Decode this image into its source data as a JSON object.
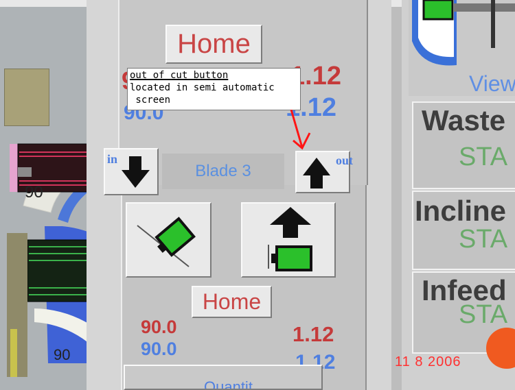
{
  "top_section": {
    "home_label": "Home",
    "red_value_left": "9",
    "red_value_right": "1.12",
    "blue_value_left": "90.0",
    "blue_value_right": "1.12"
  },
  "annotation": {
    "line1": "out of cut button",
    "line2": "located in semi automatic",
    "line3": " screen"
  },
  "blade_row": {
    "in_label": "in",
    "blade_label": "Blade 3",
    "out_label": "out"
  },
  "gauges": {
    "upper_value": "90",
    "lower_value": "90"
  },
  "bottom_section": {
    "home_label": "Home",
    "red_value_left": "90.0",
    "red_value_right": "1.12",
    "blue_value_left": "90.0",
    "blue_value_right": "1.12",
    "footer_label": "Quantit"
  },
  "right_panel": {
    "view_label": "View",
    "waste_title": "Waste",
    "waste_status": "STA",
    "incline_title": "Incline",
    "incline_status": "STA",
    "infeed_title": "Infeed",
    "infeed_status": "STA"
  },
  "date_stamp": "11  8 2006",
  "colors": {
    "home_text": "#c94545",
    "red_value": "#c53a3a",
    "blue_value": "#4f7fe0",
    "status_green": "#6aaa6a",
    "blade_text": "#5b90e0",
    "date_red": "#ff3030"
  }
}
